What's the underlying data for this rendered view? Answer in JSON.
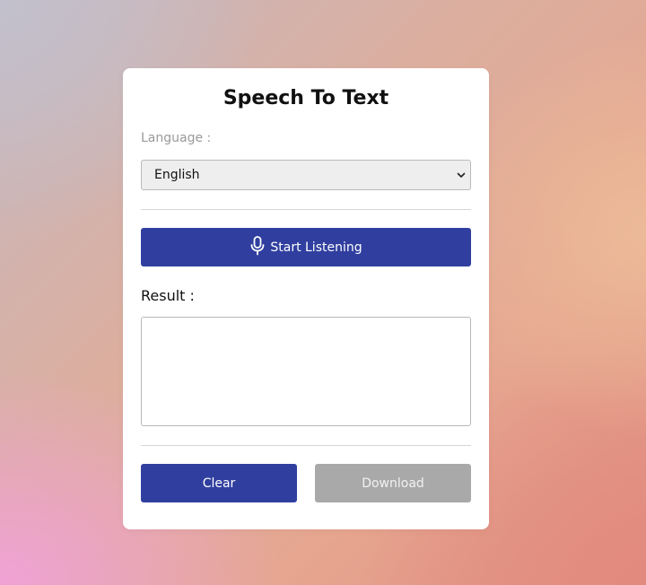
{
  "app": {
    "title": "Speech To Text"
  },
  "language": {
    "label": "Language :",
    "selected": "English"
  },
  "actions": {
    "listen_label": "Start Listening",
    "clear_label": "Clear",
    "download_label": "Download"
  },
  "result": {
    "label": "Result :",
    "value": ""
  },
  "icons": {
    "microphone": "microphone-icon",
    "dropdown": "chevron-down-icon"
  },
  "colors": {
    "primary": "#303f9f",
    "disabled": "#a9a9a9"
  }
}
